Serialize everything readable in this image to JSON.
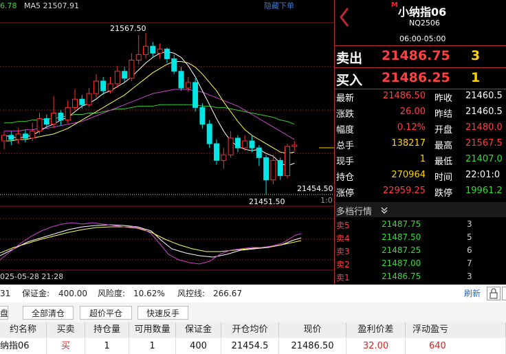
{
  "chart": {
    "ma_legend": {
      "ma_partial": "6.78",
      "ma5_label": "MA5",
      "ma5_value": "21507.91"
    },
    "hide_orders": "隐藏下单",
    "peak_label": "21567.50",
    "trough_label": "21451.50",
    "order_price_label": "21454.50",
    "ratio_label": "1:0",
    "date_label": "025-05-28 21:28",
    "colors": {
      "up": "#ff3030",
      "down": "#00e5e5",
      "ma5": "#ffffff",
      "ma10": "#ffff55",
      "ma20": "#cc44cc",
      "ma40": "#33cc33"
    }
  },
  "chart_data": {
    "type": "candlestick",
    "y_high": 21567.5,
    "y_low": 21451.5,
    "candles": [
      {
        "o": 21490,
        "c": 21494,
        "h": 21497,
        "l": 21484
      },
      {
        "o": 21494,
        "c": 21491,
        "h": 21497,
        "l": 21487
      },
      {
        "o": 21491,
        "c": 21495,
        "h": 21499,
        "l": 21488
      },
      {
        "o": 21495,
        "c": 21492,
        "h": 21498,
        "l": 21489
      },
      {
        "o": 21492,
        "c": 21497,
        "h": 21503,
        "l": 21490
      },
      {
        "o": 21497,
        "c": 21506,
        "h": 21510,
        "l": 21495
      },
      {
        "o": 21506,
        "c": 21502,
        "h": 21509,
        "l": 21499
      },
      {
        "o": 21502,
        "c": 21510,
        "h": 21522,
        "l": 21499
      },
      {
        "o": 21510,
        "c": 21505,
        "h": 21512,
        "l": 21501
      },
      {
        "o": 21505,
        "c": 21514,
        "h": 21519,
        "l": 21503
      },
      {
        "o": 21514,
        "c": 21520,
        "h": 21527,
        "l": 21512
      },
      {
        "o": 21520,
        "c": 21516,
        "h": 21523,
        "l": 21513
      },
      {
        "o": 21516,
        "c": 21524,
        "h": 21528,
        "l": 21514
      },
      {
        "o": 21524,
        "c": 21533,
        "h": 21538,
        "l": 21521
      },
      {
        "o": 21533,
        "c": 21526,
        "h": 21536,
        "l": 21523
      },
      {
        "o": 21526,
        "c": 21531,
        "h": 21536,
        "l": 21524
      },
      {
        "o": 21531,
        "c": 21540,
        "h": 21544,
        "l": 21528
      },
      {
        "o": 21540,
        "c": 21535,
        "h": 21543,
        "l": 21532
      },
      {
        "o": 21535,
        "c": 21548,
        "h": 21553,
        "l": 21533
      },
      {
        "o": 21548,
        "c": 21552,
        "h": 21566,
        "l": 21545
      },
      {
        "o": 21552,
        "c": 21558,
        "h": 21567.5,
        "l": 21549
      },
      {
        "o": 21558,
        "c": 21553,
        "h": 21561,
        "l": 21550
      },
      {
        "o": 21553,
        "c": 21556,
        "h": 21560,
        "l": 21549
      },
      {
        "o": 21556,
        "c": 21549,
        "h": 21557,
        "l": 21546
      },
      {
        "o": 21549,
        "c": 21540,
        "h": 21552,
        "l": 21538
      },
      {
        "o": 21540,
        "c": 21528,
        "h": 21543,
        "l": 21526
      },
      {
        "o": 21528,
        "c": 21532,
        "h": 21536,
        "l": 21525
      },
      {
        "o": 21532,
        "c": 21514,
        "h": 21535,
        "l": 21511
      },
      {
        "o": 21514,
        "c": 21502,
        "h": 21517,
        "l": 21499
      },
      {
        "o": 21502,
        "c": 21488,
        "h": 21505,
        "l": 21485
      },
      {
        "o": 21488,
        "c": 21476,
        "h": 21491,
        "l": 21473
      },
      {
        "o": 21476,
        "c": 21480,
        "h": 21485,
        "l": 21470
      },
      {
        "o": 21480,
        "c": 21492,
        "h": 21497,
        "l": 21478
      },
      {
        "o": 21492,
        "c": 21485,
        "h": 21494,
        "l": 21482
      },
      {
        "o": 21485,
        "c": 21490,
        "h": 21494,
        "l": 21483
      },
      {
        "o": 21490,
        "c": 21485,
        "h": 21494,
        "l": 21482
      },
      {
        "o": 21485,
        "c": 21478,
        "h": 21487,
        "l": 21472
      },
      {
        "o": 21478,
        "c": 21462,
        "h": 21480,
        "l": 21451.5
      },
      {
        "o": 21462,
        "c": 21476,
        "h": 21480,
        "l": 21459
      },
      {
        "o": 21476,
        "c": 21465,
        "h": 21478,
        "l": 21462
      },
      {
        "o": 21465,
        "c": 21486,
        "h": 21488,
        "l": 21463
      },
      {
        "o": 21486,
        "c": 21487,
        "h": 21490,
        "l": 21483
      }
    ],
    "ma5": [
      21494,
      21493,
      21492,
      21493,
      21494,
      21497,
      21500,
      21502,
      21505,
      21507,
      21511,
      21515,
      21517,
      21520,
      21524,
      21526,
      21529,
      21532,
      21536,
      21541,
      21546,
      21550,
      21553,
      21554,
      21553,
      21550,
      21544,
      21536,
      21526,
      21516,
      21506,
      21497,
      21490,
      21486,
      21484,
      21483,
      21484,
      21481,
      21479,
      21474,
      21472,
      21474
    ],
    "ma10": [
      21490,
      21490,
      21491,
      21491,
      21492,
      21493,
      21494,
      21495,
      21497,
      21499,
      21502,
      21505,
      21508,
      21511,
      21514,
      21517,
      21520,
      21523,
      21527,
      21531,
      21535,
      21539,
      21542,
      21545,
      21547,
      21547,
      21546,
      21543,
      21538,
      21532,
      21526,
      21518,
      21511,
      21504,
      21498,
      21494,
      21491,
      21488,
      21485,
      21482,
      21481,
      21482
    ],
    "ma20": [
      21497,
      21497,
      21497,
      21498,
      21498,
      21499,
      21499,
      21500,
      21501,
      21502,
      21503,
      21504,
      21506,
      21508,
      21510,
      21512,
      21514,
      21516,
      21518,
      21520,
      21522,
      21524,
      21525,
      21526,
      21527,
      21527,
      21527,
      21526,
      21525,
      21523,
      21521,
      21519,
      21517,
      21515,
      21512,
      21509,
      21506,
      21503,
      21500,
      21497,
      21494,
      21491
    ],
    "ma40": [
      21503,
      21503,
      21504,
      21504,
      21505,
      21505,
      21506,
      21506,
      21507,
      21508,
      21509,
      21509,
      21510,
      21510,
      21511,
      21512,
      21513,
      21513,
      21514,
      21515,
      21515,
      21515,
      21516,
      21516,
      21516,
      21516,
      21516,
      21516,
      21515,
      21515,
      21514,
      21514,
      21513,
      21512,
      21511,
      21510,
      21509,
      21508,
      21507,
      21505,
      21504,
      21502
    ]
  },
  "panel": {
    "contract_mark": "M",
    "title": "小纳指06",
    "code": "NQ2506",
    "hours": "06:00-05:00",
    "sell_label": "卖出",
    "sell_price": "21486.75",
    "sell_qty": "3",
    "buy_label": "买入",
    "buy_price": "21486.25",
    "buy_qty": "1",
    "quote": [
      {
        "l1": "最新",
        "v1": "21486.50",
        "c1": "red",
        "l2": "昨收",
        "v2": "21460.5",
        "c2": "white"
      },
      {
        "l1": "涨跌",
        "v1": "26.00",
        "c1": "red",
        "l2": "昨结",
        "v2": "21460.5",
        "c2": "white"
      },
      {
        "l1": "幅度",
        "v1": "0.12%",
        "c1": "red",
        "l2": "开盘",
        "v2": "21480.0",
        "c2": "red"
      },
      {
        "l1": "总手",
        "v1": "138217",
        "c1": "yellow",
        "l2": "最高",
        "v2": "21567.5",
        "c2": "red"
      },
      {
        "l1": "现手",
        "v1": "1",
        "c1": "yellow",
        "l2": "最低",
        "v2": "21407.0",
        "c2": "green"
      },
      {
        "l1": "持仓",
        "v1": "270964",
        "c1": "yellow",
        "l2": "时间",
        "v2": "22:01:0",
        "c2": "white"
      },
      {
        "l1": "涨停",
        "v1": "22959.25",
        "c1": "red",
        "l2": "跌停",
        "v2": "19961.2",
        "c2": "green"
      }
    ],
    "depth_title": "多档行情",
    "depth": [
      {
        "label": "卖5",
        "price": "21487.75",
        "qty": "3"
      },
      {
        "label": "卖4",
        "price": "21487.50",
        "qty": "5"
      },
      {
        "label": "卖3",
        "price": "21487.25",
        "qty": "6"
      },
      {
        "label": "卖2",
        "price": "21487.00",
        "qty": "7"
      },
      {
        "label": "卖1",
        "price": "21486.75",
        "qty": "3"
      }
    ]
  },
  "account": {
    "partial": "31",
    "margin_label": "保证金:",
    "margin_value": "400.00",
    "risk_label": "风险度:",
    "risk_value": "10.62%",
    "control_label": "风控线:",
    "control_value": "266.67",
    "refresh": "刷新"
  },
  "buttons": {
    "tab_partial": "盘",
    "close_all": "全部清仓",
    "over_price_close": "超价平仓",
    "fast_reverse": "快速反手"
  },
  "table": {
    "headers": [
      "约名称",
      "买卖",
      "持仓量",
      "可用数量",
      "保证金",
      "开仓均价",
      "现价",
      "盈利价差",
      "浮动盈亏"
    ],
    "row": [
      "纳指06",
      "买",
      "1",
      "1",
      "400",
      "21454.5",
      "21486.50",
      "32.00",
      "640"
    ]
  }
}
